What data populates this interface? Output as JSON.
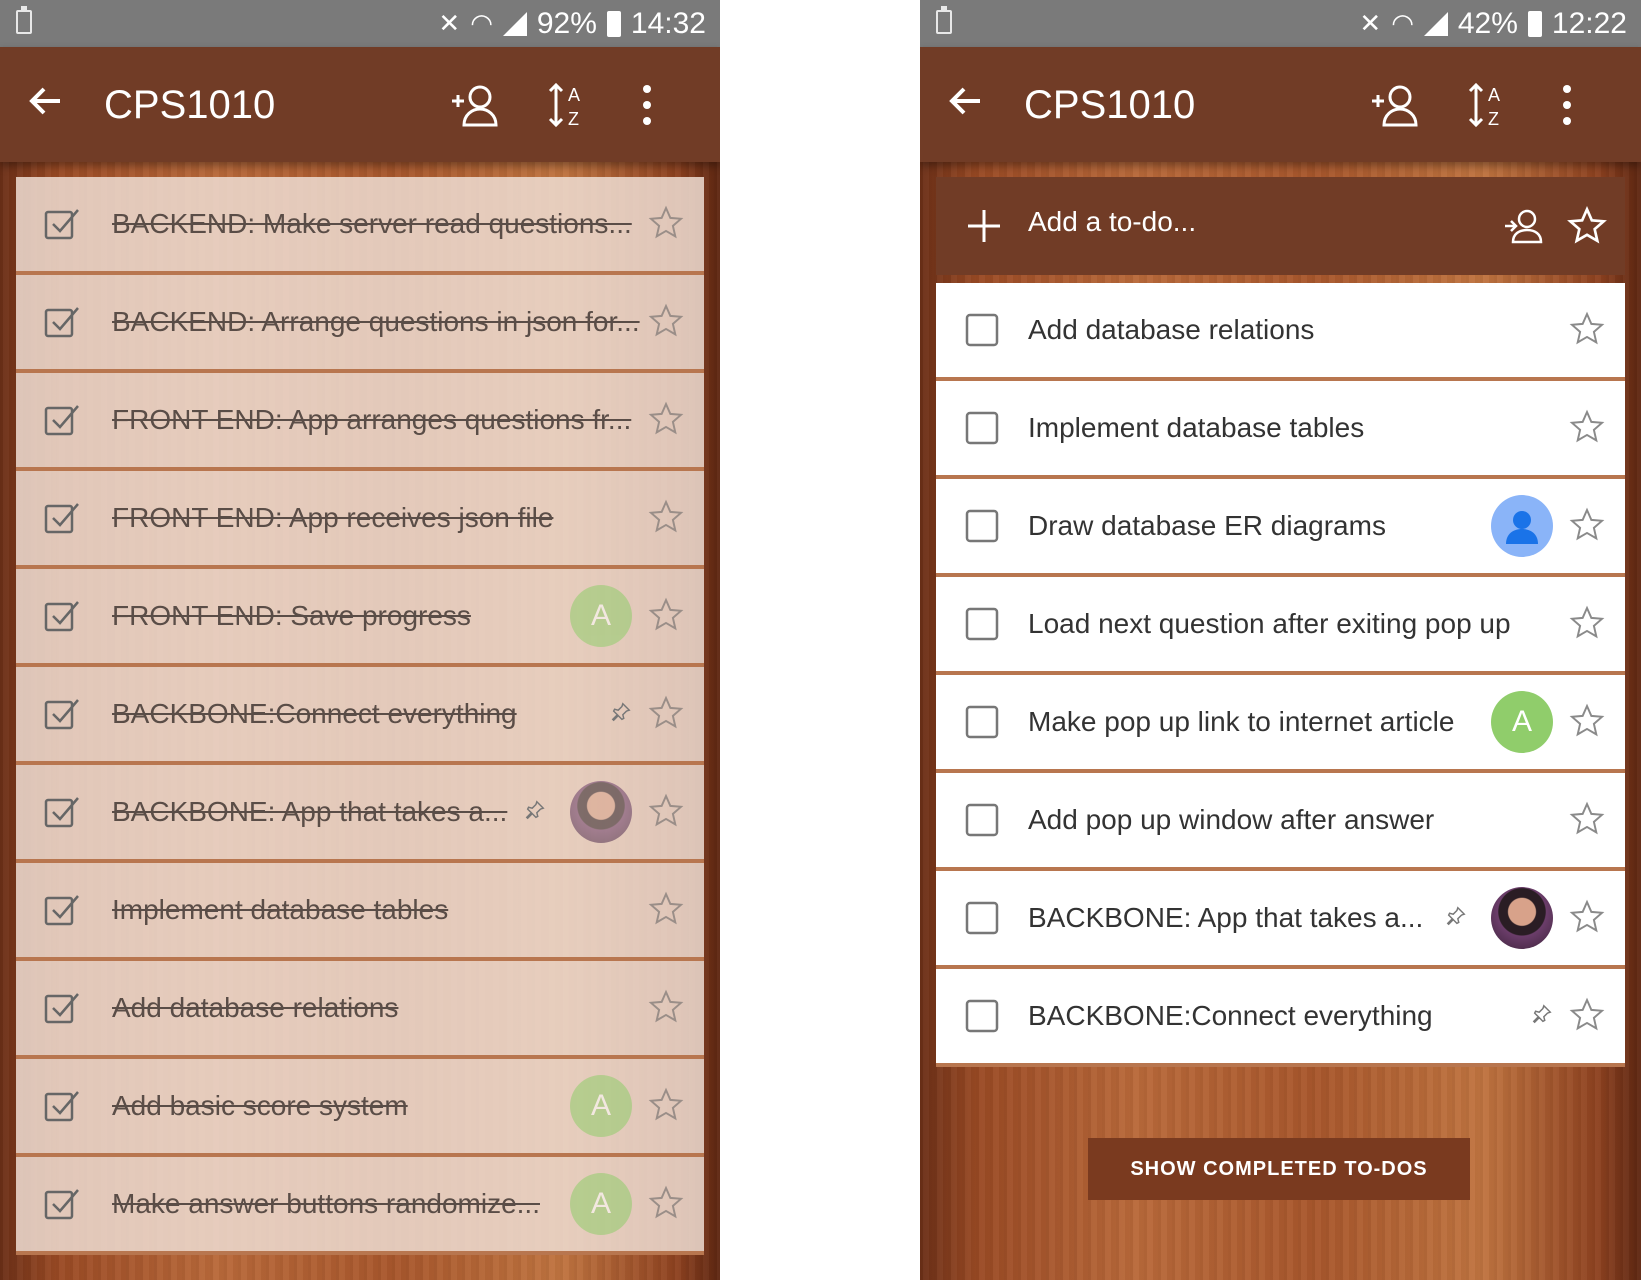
{
  "colors": {
    "appbar": "#713c26",
    "accent": "#ffffff"
  },
  "left": {
    "status": {
      "battery": "92%",
      "time": "14:32"
    },
    "title": "CPS1010",
    "items": [
      {
        "text": "BACKEND:  Make server read questions...",
        "completed": true,
        "avatar": null,
        "pin": false
      },
      {
        "text": "BACKEND: Arrange questions in json for...",
        "completed": true,
        "avatar": null,
        "pin": false
      },
      {
        "text": "FRONT END: App arranges questions fr...",
        "completed": true,
        "avatar": null,
        "pin": false
      },
      {
        "text": "FRONT END:  App receives json file",
        "completed": true,
        "avatar": null,
        "pin": false
      },
      {
        "text": "FRONT END: Save progress",
        "completed": true,
        "avatar": "A",
        "pin": false
      },
      {
        "text": "BACKBONE:Connect everything",
        "completed": true,
        "avatar": null,
        "pin": true
      },
      {
        "text": "BACKBONE: App that takes a...",
        "completed": true,
        "avatar": "photo",
        "pin": true
      },
      {
        "text": "Implement database tables",
        "completed": true,
        "avatar": null,
        "pin": false
      },
      {
        "text": "Add database relations",
        "completed": true,
        "avatar": null,
        "pin": false
      },
      {
        "text": "Add basic score system",
        "completed": true,
        "avatar": "A",
        "pin": false
      },
      {
        "text": "Make answer buttons randomize...",
        "completed": true,
        "avatar": "A",
        "pin": false
      }
    ]
  },
  "right": {
    "status": {
      "battery": "42%",
      "time": "12:22"
    },
    "title": "CPS1010",
    "add_placeholder": "Add a to-do...",
    "items": [
      {
        "text": "Add database relations",
        "completed": false,
        "avatar": null,
        "pin": false
      },
      {
        "text": "Implement database tables",
        "completed": false,
        "avatar": null,
        "pin": false
      },
      {
        "text": "Draw database ER diagrams",
        "completed": false,
        "avatar": "person",
        "pin": false
      },
      {
        "text": "Load next question after exiting pop up",
        "completed": false,
        "avatar": null,
        "pin": false
      },
      {
        "text": "Make pop up link to internet article",
        "completed": false,
        "avatar": "A",
        "pin": false
      },
      {
        "text": "Add pop up window after answer",
        "completed": false,
        "avatar": null,
        "pin": false
      },
      {
        "text": "BACKBONE: App that takes a...",
        "completed": false,
        "avatar": "photo",
        "pin": true
      },
      {
        "text": "BACKBONE:Connect everything",
        "completed": false,
        "avatar": null,
        "pin": true
      }
    ],
    "show_completed_label": "SHOW COMPLETED TO-DOS"
  }
}
